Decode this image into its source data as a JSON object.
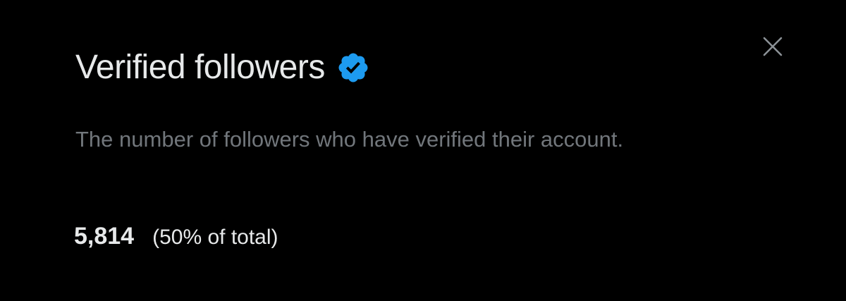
{
  "header": {
    "title": "Verified followers",
    "badge_icon": "verified-badge-icon",
    "badge_color": "#1d9bf0",
    "close_icon": "close-icon"
  },
  "description": "The number of followers who have verified their account.",
  "stats": {
    "count": "5,814",
    "share": "(50% of total)"
  },
  "colors": {
    "background": "#000000",
    "primary_text": "#e7e9ea",
    "secondary_text": "#71767b",
    "accent": "#1d9bf0"
  }
}
